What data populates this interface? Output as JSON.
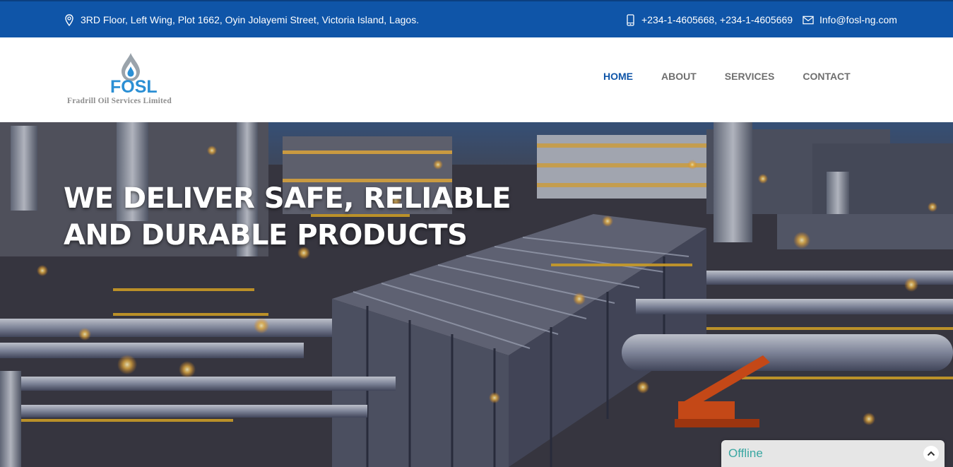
{
  "topbar": {
    "address": "3RD Floor, Left Wing, Plot 1662, Oyin Jolayemi Street, Victoria Island, Lagos.",
    "phones": "+234-1-4605668, +234-1-4605669",
    "email": "Info@fosl-ng.com",
    "icons": [
      "map-pin-icon",
      "mobile-phone-icon",
      "envelope-icon"
    ],
    "background": "#0f55a8"
  },
  "logo": {
    "mark": "FOSL",
    "company": "Fradrill Oil Services Limited"
  },
  "nav": {
    "items": [
      {
        "label": "HOME",
        "active": true
      },
      {
        "label": "ABOUT",
        "active": false
      },
      {
        "label": "SERVICES",
        "active": false
      },
      {
        "label": "CONTACT",
        "active": false
      }
    ],
    "active_color": "#0f55a8"
  },
  "hero": {
    "headline_line1": "WE DELIVER SAFE, RELIABLE",
    "headline_line2": "AND DURABLE PRODUCTS"
  },
  "chat": {
    "status": "Offline",
    "status_color": "#3aa7a2",
    "toggle_icon": "chevron-up-icon"
  }
}
